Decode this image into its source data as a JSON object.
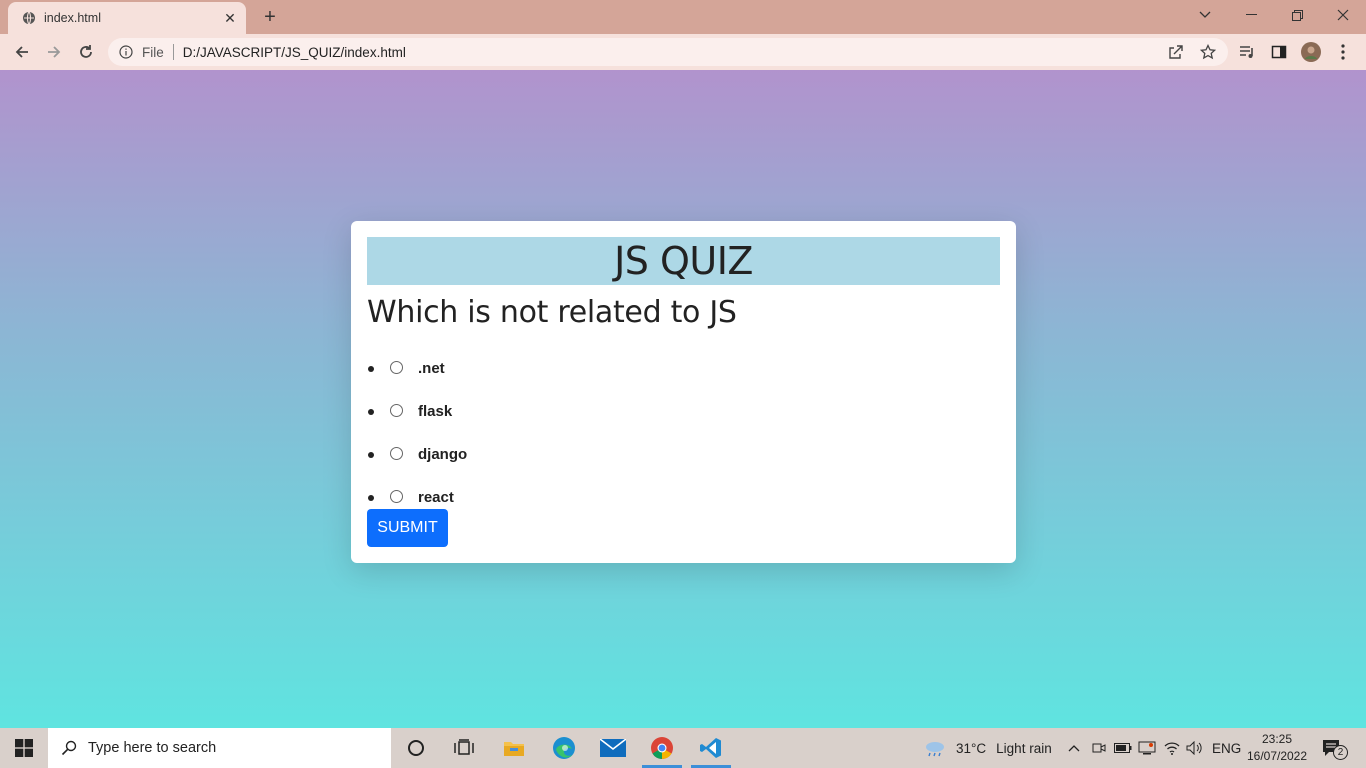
{
  "browser": {
    "tab_title": "index.html",
    "omnibox": {
      "scheme_label": "File",
      "url": "D:/JAVASCRIPT/JS_QUIZ/index.html"
    }
  },
  "page": {
    "banner_title": "JS QUIZ",
    "question": "Which is not related to JS",
    "options": [
      ".net",
      "flask",
      "django",
      "react"
    ],
    "submit_label": "SUBMIT"
  },
  "taskbar": {
    "search_placeholder": "Type here to search",
    "weather_temp": "31°C",
    "weather_desc": "Light rain",
    "language": "ENG",
    "time": "23:25",
    "date": "16/07/2022",
    "notification_count": "2"
  },
  "colors": {
    "banner": "#add8e6",
    "submit": "#0d6efd",
    "gradient_top": "#b193cd",
    "gradient_bottom": "#5fe4e0"
  }
}
